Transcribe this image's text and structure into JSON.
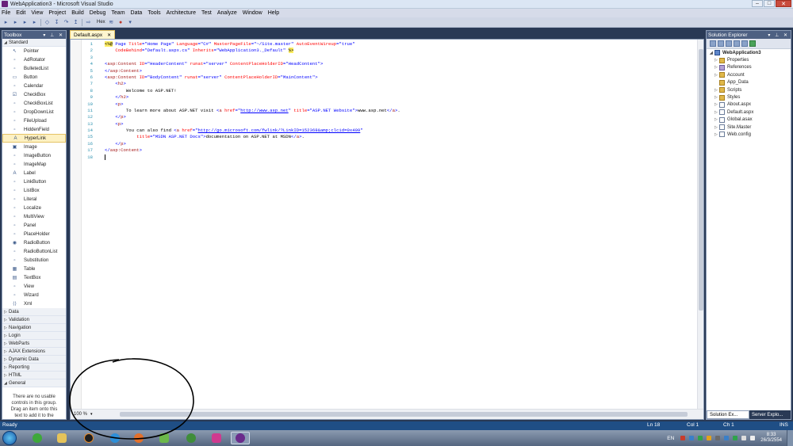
{
  "window": {
    "title": "WebApplication3 - Microsoft Visual Studio"
  },
  "menu": [
    "File",
    "Edit",
    "View",
    "Project",
    "Build",
    "Debug",
    "Team",
    "Data",
    "Tools",
    "Architecture",
    "Test",
    "Analyze",
    "Window",
    "Help"
  ],
  "toolbar": {
    "hex_label": "Hex"
  },
  "toolbox": {
    "title": "Toolbox",
    "standard_group": "Standard",
    "items": [
      "Pointer",
      "AdRotator",
      "BulletedList",
      "Button",
      "Calendar",
      "CheckBox",
      "CheckBoxList",
      "DropDownList",
      "FileUpload",
      "HiddenField",
      "HyperLink",
      "Image",
      "ImageButton",
      "ImageMap",
      "Label",
      "LinkButton",
      "ListBox",
      "Literal",
      "Localize",
      "MultiView",
      "Panel",
      "PlaceHolder",
      "RadioButton",
      "RadioButtonList",
      "Substitution",
      "Table",
      "TextBox",
      "View",
      "Wizard",
      "Xml"
    ],
    "selected_item": "HyperLink",
    "groups": [
      "Data",
      "Validation",
      "Navigation",
      "Login",
      "WebParts",
      "AJAX Extensions",
      "Dynamic Data",
      "Reporting",
      "HTML",
      "General"
    ],
    "empty_message": "There are no usable controls in this group. Drag an item onto this text to add it to the"
  },
  "editor": {
    "tab_label": "Default.aspx",
    "zoom": "100 %",
    "line_numbers": [
      "1",
      "2",
      "3",
      "4",
      "5",
      "6",
      "7",
      "8",
      "9",
      "10",
      "11",
      "12",
      "13",
      "14",
      "15",
      "16",
      "17",
      "18"
    ],
    "lines": [
      [
        [
          "hl",
          "<%@"
        ],
        [
          "bl",
          " Page "
        ],
        [
          "rd",
          "Title"
        ],
        [
          "bl",
          "=\"Home Page\" "
        ],
        [
          "rd",
          "Language"
        ],
        [
          "bl",
          "=\"C#\" "
        ],
        [
          "rd",
          "MasterPageFile"
        ],
        [
          "bl",
          "=\"~/Site.master\" "
        ],
        [
          "rd",
          "AutoEventWireup"
        ],
        [
          "bl",
          "=\"true\""
        ]
      ],
      [
        [
          "rd",
          "    CodeBehind"
        ],
        [
          "bl",
          "=\"Default.aspx.cs\" "
        ],
        [
          "rd",
          "Inherits"
        ],
        [
          "bl",
          "=\"WebApplication3._Default\" "
        ],
        [
          "hl",
          "%>"
        ]
      ],
      [],
      [
        [
          "bl",
          "<"
        ],
        [
          "mr",
          "asp:Content"
        ],
        [
          "bl",
          " "
        ],
        [
          "rd",
          "ID"
        ],
        [
          "bl",
          "=\"HeaderContent\" "
        ],
        [
          "rd",
          "runat"
        ],
        [
          "bl",
          "=\"server\" "
        ],
        [
          "rd",
          "ContentPlaceHolderID"
        ],
        [
          "bl",
          "=\"HeadContent\">"
        ]
      ],
      [
        [
          "bl",
          "</"
        ],
        [
          "mr",
          "asp:Content"
        ],
        [
          "bl",
          ">"
        ]
      ],
      [
        [
          "bl",
          "<"
        ],
        [
          "mr",
          "asp:Content"
        ],
        [
          "bl",
          " "
        ],
        [
          "rd",
          "ID"
        ],
        [
          "bl",
          "=\"BodyContent\" "
        ],
        [
          "rd",
          "runat"
        ],
        [
          "bl",
          "=\"server\" "
        ],
        [
          "rd",
          "ContentPlaceHolderID"
        ],
        [
          "bl",
          "=\"MainContent\">"
        ]
      ],
      [
        [
          "bl",
          "    <"
        ],
        [
          "mr",
          "h2"
        ],
        [
          "bl",
          ">"
        ]
      ],
      [
        [
          "tx",
          "        Welcome to ASP.NET!"
        ]
      ],
      [
        [
          "bl",
          "    </"
        ],
        [
          "mr",
          "h2"
        ],
        [
          "bl",
          ">"
        ]
      ],
      [
        [
          "bl",
          "    <"
        ],
        [
          "mr",
          "p"
        ],
        [
          "bl",
          ">"
        ]
      ],
      [
        [
          "tx",
          "        To learn more about ASP.NET visit "
        ],
        [
          "bl",
          "<"
        ],
        [
          "mr",
          "a"
        ],
        [
          "bl",
          " "
        ],
        [
          "rd",
          "href"
        ],
        [
          "bl",
          "=\""
        ],
        [
          "ul",
          "http://www.asp.net"
        ],
        [
          "bl",
          "\" "
        ],
        [
          "rd",
          "title"
        ],
        [
          "bl",
          "=\"ASP.NET Website\">"
        ],
        [
          "tx",
          "www.asp.net"
        ],
        [
          "bl",
          "</"
        ],
        [
          "mr",
          "a"
        ],
        [
          "bl",
          ">"
        ],
        [
          "tx",
          "."
        ]
      ],
      [
        [
          "bl",
          "    </"
        ],
        [
          "mr",
          "p"
        ],
        [
          "bl",
          ">"
        ]
      ],
      [
        [
          "bl",
          "    <"
        ],
        [
          "mr",
          "p"
        ],
        [
          "bl",
          ">"
        ]
      ],
      [
        [
          "tx",
          "        You can also find "
        ],
        [
          "bl",
          "<"
        ],
        [
          "mr",
          "a"
        ],
        [
          "bl",
          " "
        ],
        [
          "rd",
          "href"
        ],
        [
          "bl",
          "=\""
        ],
        [
          "ul",
          "http://go.microsoft.com/fwlink/?LinkID=152368&amp;clcid=0x409"
        ],
        [
          "bl",
          "\""
        ]
      ],
      [
        [
          "rd",
          "            title"
        ],
        [
          "bl",
          "=\"MSDN ASP.NET Docs\">"
        ],
        [
          "tx",
          "documentation on ASP.NET at MSDN"
        ],
        [
          "bl",
          "</"
        ],
        [
          "mr",
          "a"
        ],
        [
          "bl",
          ">"
        ],
        [
          "tx",
          "."
        ]
      ],
      [
        [
          "bl",
          "    </"
        ],
        [
          "mr",
          "p"
        ],
        [
          "bl",
          ">"
        ]
      ],
      [
        [
          "bl",
          "</"
        ],
        [
          "mr",
          "asp:Content"
        ],
        [
          "bl",
          ">"
        ]
      ],
      []
    ]
  },
  "solution_explorer": {
    "title": "Solution Explorer",
    "nodes": [
      {
        "label": "WebApplication3",
        "kind": "proj",
        "depth": 0,
        "expander": "◢"
      },
      {
        "label": "Properties",
        "kind": "folder",
        "depth": 1,
        "expander": "▷"
      },
      {
        "label": "References",
        "kind": "ref",
        "depth": 1,
        "expander": "▷"
      },
      {
        "label": "Account",
        "kind": "folder",
        "depth": 1,
        "expander": "▷"
      },
      {
        "label": "App_Data",
        "kind": "folder",
        "depth": 1,
        "expander": ""
      },
      {
        "label": "Scripts",
        "kind": "folder",
        "depth": 1,
        "expander": "▷"
      },
      {
        "label": "Styles",
        "kind": "folder",
        "depth": 1,
        "expander": "▷"
      },
      {
        "label": "About.aspx",
        "kind": "file",
        "depth": 1,
        "expander": "▷"
      },
      {
        "label": "Default.aspx",
        "kind": "file",
        "depth": 1,
        "expander": "▷"
      },
      {
        "label": "Global.asax",
        "kind": "file",
        "depth": 1,
        "expander": "▷"
      },
      {
        "label": "Site.Master",
        "kind": "file",
        "depth": 1,
        "expander": "▷"
      },
      {
        "label": "Web.config",
        "kind": "file",
        "depth": 1,
        "expander": "▷"
      }
    ],
    "tab_solution": "Solution Ex...",
    "tab_server": "Server Explo..."
  },
  "status": {
    "message": "Ready",
    "line": "Ln 18",
    "col": "Col 1",
    "ch": "Ch 1",
    "mode": "INS"
  },
  "taskbar": {
    "lang": "EN",
    "time": "8:33",
    "date": "26/3/2554"
  },
  "colors": {
    "chrome": "#293955",
    "panel_header": "#4d6082",
    "selection": "#fdf1c3",
    "keyword_blue": "#0000ff",
    "tag_maroon": "#a31515",
    "attr_red": "#ff0000"
  }
}
